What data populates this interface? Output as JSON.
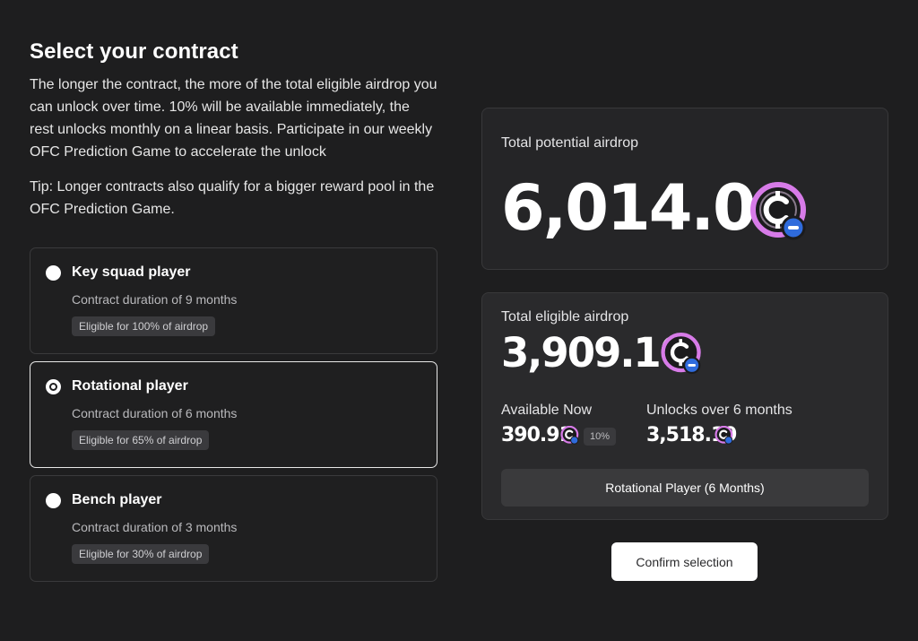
{
  "header": {
    "title": "Select your contract",
    "description": "The longer the contract, the more of the total eligible airdrop you can unlock over time. 10% will be available immediately, the rest unlocks monthly on a linear basis. Participate in our weekly OFC Prediction Game to accelerate the unlock",
    "tip": "Tip: Longer contracts also qualify for a bigger reward pool in the OFC Prediction Game."
  },
  "options": [
    {
      "name": "Key squad player",
      "duration": "Contract duration of 9 months",
      "badge": "Eligible for 100% of airdrop",
      "selected": false
    },
    {
      "name": "Rotational player",
      "duration": "Contract duration of 6 months",
      "badge": "Eligible for 65% of airdrop",
      "selected": true
    },
    {
      "name": "Bench player",
      "duration": "Contract duration of 3 months",
      "badge": "Eligible for 30% of airdrop",
      "selected": false
    }
  ],
  "potential": {
    "label": "Total potential airdrop",
    "amount": "6,014.00",
    "icon": "ofc-coin-icon"
  },
  "eligible": {
    "label": "Total eligible airdrop",
    "amount": "3,909.10",
    "available_label": "Available Now",
    "available_amount": "390.91",
    "available_percent": "10%",
    "unlocks_label": "Unlocks over 6 months",
    "unlocks_amount": "3,518.19",
    "selection": "Rotational Player (6 Months)"
  },
  "actions": {
    "confirm_label": "Confirm selection"
  },
  "colors": {
    "background": "#1e1e1f",
    "coin_ring": "#d77be8",
    "coin_badge": "#2f6bdc"
  }
}
